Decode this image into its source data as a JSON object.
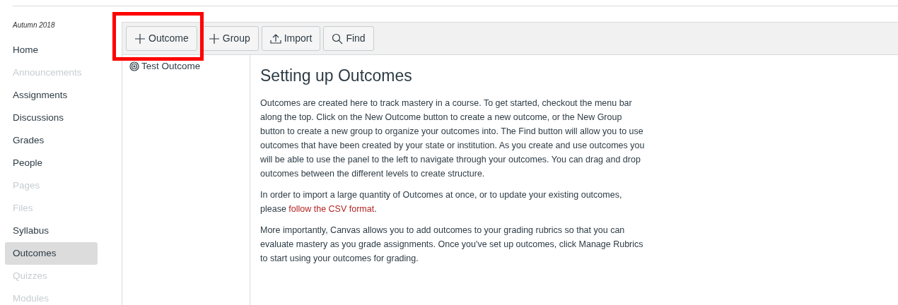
{
  "course_term": "Autumn 2018",
  "nav_items": [
    {
      "label": "Home",
      "disabled": false,
      "selected": false
    },
    {
      "label": "Announcements",
      "disabled": true,
      "selected": false
    },
    {
      "label": "Assignments",
      "disabled": false,
      "selected": false
    },
    {
      "label": "Discussions",
      "disabled": false,
      "selected": false
    },
    {
      "label": "Grades",
      "disabled": false,
      "selected": false
    },
    {
      "label": "People",
      "disabled": false,
      "selected": false
    },
    {
      "label": "Pages",
      "disabled": true,
      "selected": false
    },
    {
      "label": "Files",
      "disabled": true,
      "selected": false
    },
    {
      "label": "Syllabus",
      "disabled": false,
      "selected": false
    },
    {
      "label": "Outcomes",
      "disabled": false,
      "selected": true
    },
    {
      "label": "Quizzes",
      "disabled": true,
      "selected": false
    },
    {
      "label": "Modules",
      "disabled": true,
      "selected": false
    }
  ],
  "toolbar": [
    {
      "label": "Outcome",
      "kind": "plus",
      "highlighted": true
    },
    {
      "label": "Group",
      "kind": "plus",
      "highlighted": false
    },
    {
      "label": "Import",
      "kind": "import",
      "highlighted": false
    },
    {
      "label": "Find",
      "kind": "search",
      "highlighted": false
    }
  ],
  "outcomes_tree": [
    {
      "label": "Test Outcome"
    }
  ],
  "content": {
    "title": "Setting up Outcomes",
    "paragraphs": [
      [
        {
          "kind": "text",
          "text": "Outcomes are created here to track mastery in a course. To get started, checkout the menu bar along the top. Click on the New Outcome button to create a new outcome, or the New Group button to create a new group to organize your outcomes into. The Find button will allow you to use outcomes that have been created by your state or institution. As you create and use outcomes you will be able to use the panel to the left to navigate through your outcomes. You can drag and drop outcomes between the different levels to create structure."
        }
      ],
      [
        {
          "kind": "text",
          "text": "In order to import a large quantity of Outcomes at once, or to update your existing outcomes, please "
        },
        {
          "kind": "link",
          "text": "follow the CSV format"
        },
        {
          "kind": "text",
          "text": "."
        }
      ],
      [
        {
          "kind": "text",
          "text": "More importantly, Canvas allows you to add outcomes to your grading rubrics so that you can evaluate mastery as you grade assignments. Once you've set up outcomes, click Manage Rubrics to start using your outcomes for grading."
        }
      ]
    ]
  }
}
